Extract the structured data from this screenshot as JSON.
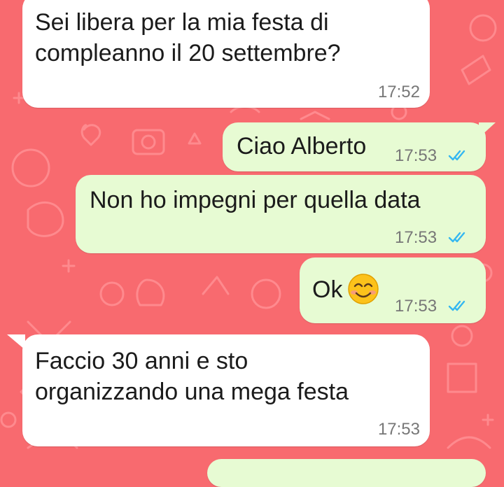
{
  "chat": {
    "messages": [
      {
        "direction": "incoming",
        "lines": [
          "Sei libera per la mia festa di",
          "compleanno il 20 settembre?"
        ],
        "time": "17:52"
      },
      {
        "direction": "outgoing",
        "text": "Ciao Alberto",
        "time": "17:53",
        "status": "read"
      },
      {
        "direction": "outgoing",
        "text": "Non ho impegni per quella data",
        "time": "17:53",
        "status": "read"
      },
      {
        "direction": "outgoing",
        "text": "Ok",
        "emoji": "smiling-face-icon",
        "time": "17:53",
        "status": "read"
      },
      {
        "direction": "incoming",
        "lines": [
          "Faccio 30 anni e sto",
          "organizzando una mega festa"
        ],
        "time": "17:53"
      }
    ]
  },
  "colors": {
    "wallpaper": "#f86a6f",
    "incoming_bubble": "#ffffff",
    "outgoing_bubble": "#e7fbd3",
    "read_ticks": "#34b7f1",
    "timestamp": "#777777"
  }
}
